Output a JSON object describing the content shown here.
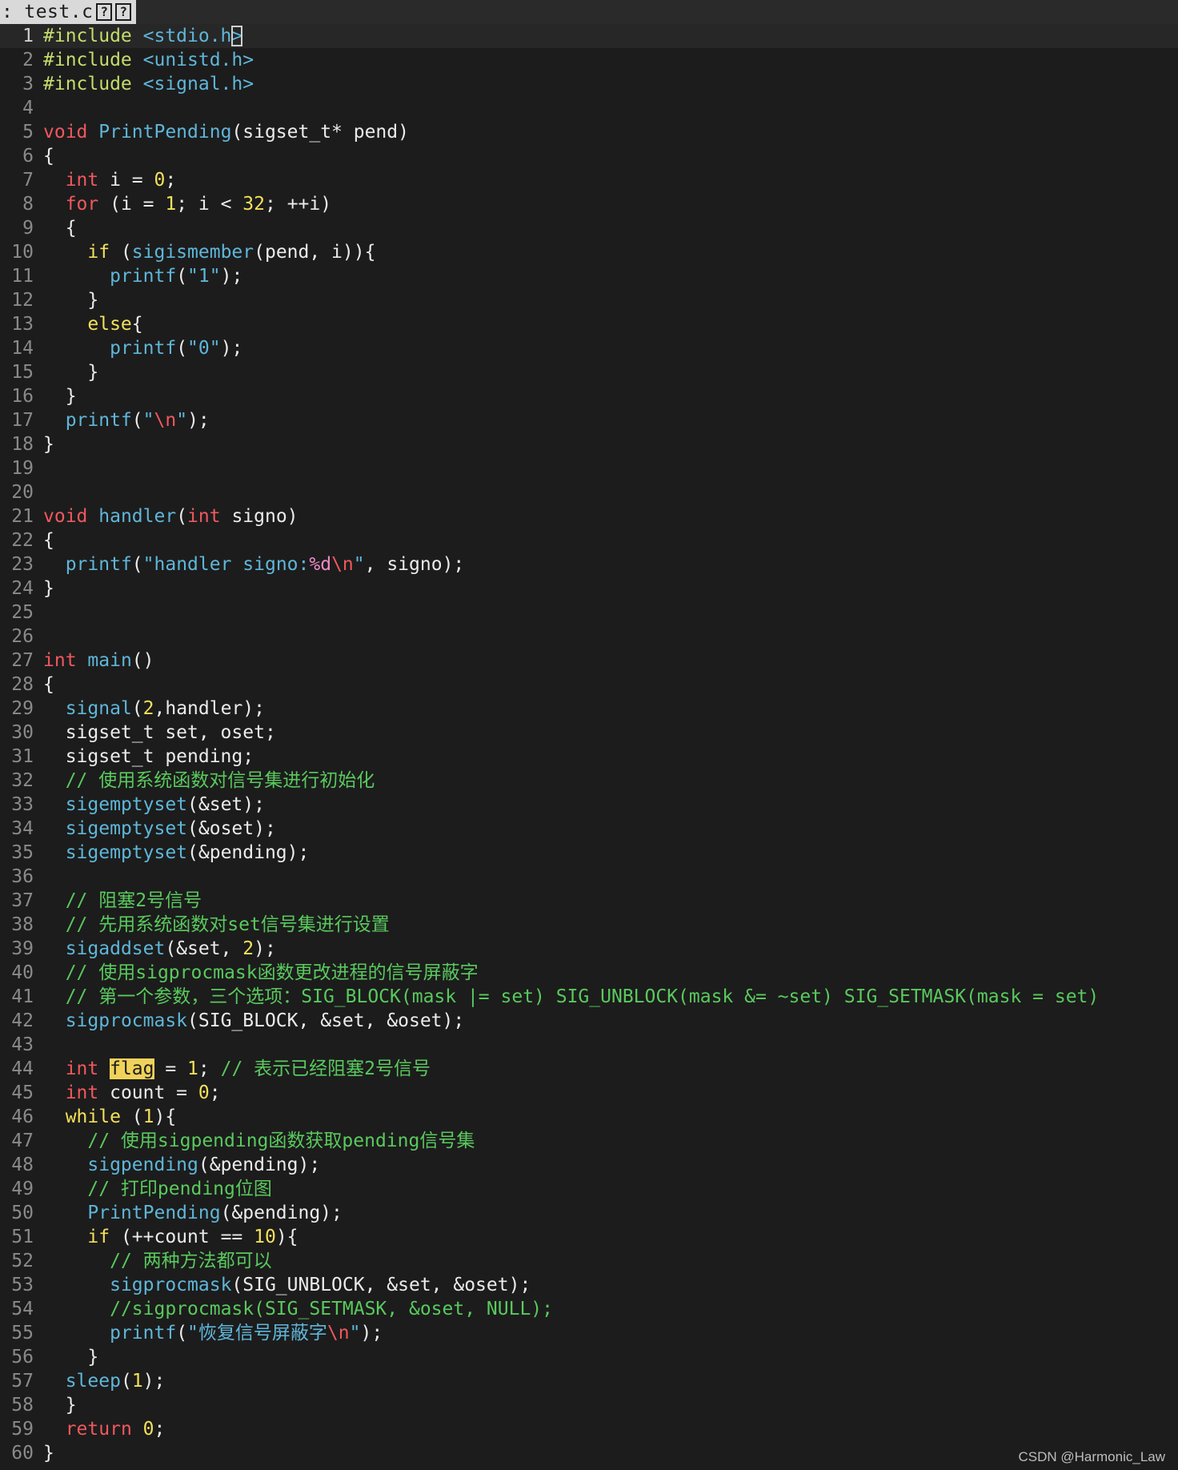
{
  "tab": {
    "prefix": ":",
    "filename": "test.c",
    "icons": [
      "?",
      "?"
    ]
  },
  "watermark": "CSDN @Harmonic_Law",
  "current_line": 1,
  "colors": {
    "background": "#1c1c1c",
    "preprocessor": "#c3dd6b",
    "keyword": "#f0585e",
    "function": "#5fb6d9",
    "number": "#f3e05a",
    "comment": "#59c95d",
    "search_highlight": "#f0d25a"
  },
  "lines": [
    {
      "n": "1",
      "tokens": [
        [
          "t-pre",
          "#include "
        ],
        [
          "t-hdr",
          "<stdio.h"
        ],
        [
          "t-hdr t-cur",
          ">"
        ]
      ]
    },
    {
      "n": "2",
      "tokens": [
        [
          "t-pre",
          "#include "
        ],
        [
          "t-hdr",
          "<unistd.h>"
        ]
      ]
    },
    {
      "n": "3",
      "tokens": [
        [
          "t-pre",
          "#include "
        ],
        [
          "t-hdr",
          "<signal.h>"
        ]
      ]
    },
    {
      "n": "4",
      "tokens": []
    },
    {
      "n": "5",
      "tokens": [
        [
          "t-kw",
          "void"
        ],
        [
          "t-txt",
          " "
        ],
        [
          "t-fn",
          "PrintPending"
        ],
        [
          "t-txt",
          "(sigset_t* pend)"
        ]
      ]
    },
    {
      "n": "6",
      "tokens": [
        [
          "t-txt",
          "{"
        ]
      ]
    },
    {
      "n": "7",
      "tokens": [
        [
          "t-txt",
          "  "
        ],
        [
          "t-kw",
          "int"
        ],
        [
          "t-txt",
          " i = "
        ],
        [
          "t-num",
          "0"
        ],
        [
          "t-txt",
          ";"
        ]
      ]
    },
    {
      "n": "8",
      "tokens": [
        [
          "t-txt",
          "  "
        ],
        [
          "t-kw",
          "for"
        ],
        [
          "t-txt",
          " (i = "
        ],
        [
          "t-num",
          "1"
        ],
        [
          "t-txt",
          "; i < "
        ],
        [
          "t-num",
          "32"
        ],
        [
          "t-txt",
          "; ++i)"
        ]
      ]
    },
    {
      "n": "9",
      "tokens": [
        [
          "t-txt",
          "  {"
        ]
      ]
    },
    {
      "n": "10",
      "tokens": [
        [
          "t-txt",
          "    "
        ],
        [
          "t-ctl",
          "if"
        ],
        [
          "t-txt",
          " ("
        ],
        [
          "t-fn",
          "sigismember"
        ],
        [
          "t-txt",
          "(pend, i)){"
        ]
      ]
    },
    {
      "n": "11",
      "tokens": [
        [
          "t-txt",
          "      "
        ],
        [
          "t-fn",
          "printf"
        ],
        [
          "t-txt",
          "("
        ],
        [
          "t-str",
          "\"1\""
        ],
        [
          "t-txt",
          ");"
        ]
      ]
    },
    {
      "n": "12",
      "tokens": [
        [
          "t-txt",
          "    }"
        ]
      ]
    },
    {
      "n": "13",
      "tokens": [
        [
          "t-txt",
          "    "
        ],
        [
          "t-ctl",
          "else"
        ],
        [
          "t-txt",
          "{"
        ]
      ]
    },
    {
      "n": "14",
      "tokens": [
        [
          "t-txt",
          "      "
        ],
        [
          "t-fn",
          "printf"
        ],
        [
          "t-txt",
          "("
        ],
        [
          "t-str",
          "\"0\""
        ],
        [
          "t-txt",
          ");"
        ]
      ]
    },
    {
      "n": "15",
      "tokens": [
        [
          "t-txt",
          "    }"
        ]
      ]
    },
    {
      "n": "16",
      "tokens": [
        [
          "t-txt",
          "  }"
        ]
      ]
    },
    {
      "n": "17",
      "tokens": [
        [
          "t-txt",
          "  "
        ],
        [
          "t-fn",
          "printf"
        ],
        [
          "t-txt",
          "("
        ],
        [
          "t-str",
          "\""
        ],
        [
          "t-esc",
          "\\n"
        ],
        [
          "t-str",
          "\""
        ],
        [
          "t-txt",
          ");"
        ]
      ]
    },
    {
      "n": "18",
      "tokens": [
        [
          "t-txt",
          "}"
        ]
      ]
    },
    {
      "n": "19",
      "tokens": []
    },
    {
      "n": "20",
      "tokens": []
    },
    {
      "n": "21",
      "tokens": [
        [
          "t-kw",
          "void"
        ],
        [
          "t-txt",
          " "
        ],
        [
          "t-fn",
          "handler"
        ],
        [
          "t-txt",
          "("
        ],
        [
          "t-kw",
          "int"
        ],
        [
          "t-txt",
          " signo)"
        ]
      ]
    },
    {
      "n": "22",
      "tokens": [
        [
          "t-txt",
          "{"
        ]
      ]
    },
    {
      "n": "23",
      "tokens": [
        [
          "t-txt",
          "  "
        ],
        [
          "t-fn",
          "printf"
        ],
        [
          "t-txt",
          "("
        ],
        [
          "t-str",
          "\"handler signo:"
        ],
        [
          "t-fmt",
          "%d"
        ],
        [
          "t-esc",
          "\\n"
        ],
        [
          "t-str",
          "\""
        ],
        [
          "t-txt",
          ", signo);"
        ]
      ]
    },
    {
      "n": "24",
      "tokens": [
        [
          "t-txt",
          "}"
        ]
      ]
    },
    {
      "n": "25",
      "tokens": []
    },
    {
      "n": "26",
      "tokens": []
    },
    {
      "n": "27",
      "tokens": [
        [
          "t-kw",
          "int"
        ],
        [
          "t-txt",
          " "
        ],
        [
          "t-fn",
          "main"
        ],
        [
          "t-txt",
          "()"
        ]
      ]
    },
    {
      "n": "28",
      "tokens": [
        [
          "t-txt",
          "{"
        ]
      ]
    },
    {
      "n": "29",
      "tokens": [
        [
          "t-txt",
          "  "
        ],
        [
          "t-fn",
          "signal"
        ],
        [
          "t-txt",
          "("
        ],
        [
          "t-num",
          "2"
        ],
        [
          "t-txt",
          ",handler);"
        ]
      ]
    },
    {
      "n": "30",
      "tokens": [
        [
          "t-txt",
          "  sigset_t set, oset;"
        ]
      ]
    },
    {
      "n": "31",
      "tokens": [
        [
          "t-txt",
          "  sigset_t pending;"
        ]
      ]
    },
    {
      "n": "32",
      "tokens": [
        [
          "t-txt",
          "  "
        ],
        [
          "t-com",
          "// 使用系统函数对信号集进行初始化"
        ]
      ]
    },
    {
      "n": "33",
      "tokens": [
        [
          "t-txt",
          "  "
        ],
        [
          "t-fn",
          "sigemptyset"
        ],
        [
          "t-txt",
          "(&set);"
        ]
      ]
    },
    {
      "n": "34",
      "tokens": [
        [
          "t-txt",
          "  "
        ],
        [
          "t-fn",
          "sigemptyset"
        ],
        [
          "t-txt",
          "(&oset);"
        ]
      ]
    },
    {
      "n": "35",
      "tokens": [
        [
          "t-txt",
          "  "
        ],
        [
          "t-fn",
          "sigemptyset"
        ],
        [
          "t-txt",
          "(&pending);"
        ]
      ]
    },
    {
      "n": "36",
      "tokens": []
    },
    {
      "n": "37",
      "tokens": [
        [
          "t-txt",
          "  "
        ],
        [
          "t-com",
          "// 阻塞2号信号"
        ]
      ]
    },
    {
      "n": "38",
      "tokens": [
        [
          "t-txt",
          "  "
        ],
        [
          "t-com",
          "// 先用系统函数对set信号集进行设置"
        ]
      ]
    },
    {
      "n": "39",
      "tokens": [
        [
          "t-txt",
          "  "
        ],
        [
          "t-fn",
          "sigaddset"
        ],
        [
          "t-txt",
          "(&set, "
        ],
        [
          "t-num",
          "2"
        ],
        [
          "t-txt",
          ");"
        ]
      ]
    },
    {
      "n": "40",
      "tokens": [
        [
          "t-txt",
          "  "
        ],
        [
          "t-com",
          "// 使用sigprocmask函数更改进程的信号屏蔽字"
        ]
      ]
    },
    {
      "n": "41",
      "tokens": [
        [
          "t-txt",
          "  "
        ],
        [
          "t-com",
          "// 第一个参数，三个选项：SIG_BLOCK(mask |= set) SIG_UNBLOCK(mask &= ~set) SIG_SETMASK(mask = set)"
        ]
      ]
    },
    {
      "n": "42",
      "tokens": [
        [
          "t-txt",
          "  "
        ],
        [
          "t-fn",
          "sigprocmask"
        ],
        [
          "t-txt",
          "(SIG_BLOCK, &set, &oset);"
        ]
      ]
    },
    {
      "n": "43",
      "tokens": []
    },
    {
      "n": "44",
      "tokens": [
        [
          "t-txt",
          "  "
        ],
        [
          "t-kw",
          "int"
        ],
        [
          "t-txt",
          " "
        ],
        [
          "t-hl",
          "flag"
        ],
        [
          "t-txt",
          " = "
        ],
        [
          "t-num",
          "1"
        ],
        [
          "t-txt",
          "; "
        ],
        [
          "t-com",
          "// 表示已经阻塞2号信号"
        ]
      ]
    },
    {
      "n": "45",
      "tokens": [
        [
          "t-txt",
          "  "
        ],
        [
          "t-kw",
          "int"
        ],
        [
          "t-txt",
          " count = "
        ],
        [
          "t-num",
          "0"
        ],
        [
          "t-txt",
          ";"
        ]
      ]
    },
    {
      "n": "46",
      "tokens": [
        [
          "t-txt",
          "  "
        ],
        [
          "t-ctl",
          "while"
        ],
        [
          "t-txt",
          " ("
        ],
        [
          "t-num",
          "1"
        ],
        [
          "t-txt",
          "){"
        ]
      ]
    },
    {
      "n": "47",
      "tokens": [
        [
          "t-txt",
          "    "
        ],
        [
          "t-com",
          "// 使用sigpending函数获取pending信号集"
        ]
      ]
    },
    {
      "n": "48",
      "tokens": [
        [
          "t-txt",
          "    "
        ],
        [
          "t-fn",
          "sigpending"
        ],
        [
          "t-txt",
          "(&pending);"
        ]
      ]
    },
    {
      "n": "49",
      "tokens": [
        [
          "t-txt",
          "    "
        ],
        [
          "t-com",
          "// 打印pending位图"
        ]
      ]
    },
    {
      "n": "50",
      "tokens": [
        [
          "t-txt",
          "    "
        ],
        [
          "t-fn",
          "PrintPending"
        ],
        [
          "t-txt",
          "(&pending);"
        ]
      ]
    },
    {
      "n": "51",
      "tokens": [
        [
          "t-txt",
          "    "
        ],
        [
          "t-ctl",
          "if"
        ],
        [
          "t-txt",
          " (++count == "
        ],
        [
          "t-num",
          "10"
        ],
        [
          "t-txt",
          "){"
        ]
      ]
    },
    {
      "n": "52",
      "tokens": [
        [
          "t-txt",
          "      "
        ],
        [
          "t-com",
          "// 两种方法都可以"
        ]
      ]
    },
    {
      "n": "53",
      "tokens": [
        [
          "t-txt",
          "      "
        ],
        [
          "t-fn",
          "sigprocmask"
        ],
        [
          "t-txt",
          "(SIG_UNBLOCK, &set, &oset);"
        ]
      ]
    },
    {
      "n": "54",
      "tokens": [
        [
          "t-txt",
          "      "
        ],
        [
          "t-com",
          "//sigprocmask(SIG_SETMASK, &oset, NULL);"
        ]
      ]
    },
    {
      "n": "55",
      "tokens": [
        [
          "t-txt",
          "      "
        ],
        [
          "t-fn",
          "printf"
        ],
        [
          "t-txt",
          "("
        ],
        [
          "t-str",
          "\"恢复信号屏蔽字"
        ],
        [
          "t-esc",
          "\\n"
        ],
        [
          "t-str",
          "\""
        ],
        [
          "t-txt",
          ");"
        ]
      ]
    },
    {
      "n": "56",
      "tokens": [
        [
          "t-txt",
          "    }"
        ]
      ]
    },
    {
      "n": "57",
      "tokens": [
        [
          "t-txt",
          "  "
        ],
        [
          "t-fn",
          "sleep"
        ],
        [
          "t-txt",
          "("
        ],
        [
          "t-num",
          "1"
        ],
        [
          "t-txt",
          ");"
        ]
      ]
    },
    {
      "n": "58",
      "tokens": [
        [
          "t-txt",
          "  }"
        ]
      ]
    },
    {
      "n": "59",
      "tokens": [
        [
          "t-txt",
          "  "
        ],
        [
          "t-kw",
          "return"
        ],
        [
          "t-txt",
          " "
        ],
        [
          "t-num",
          "0"
        ],
        [
          "t-txt",
          ";"
        ]
      ]
    },
    {
      "n": "60",
      "tokens": [
        [
          "t-txt",
          "}"
        ]
      ]
    }
  ]
}
